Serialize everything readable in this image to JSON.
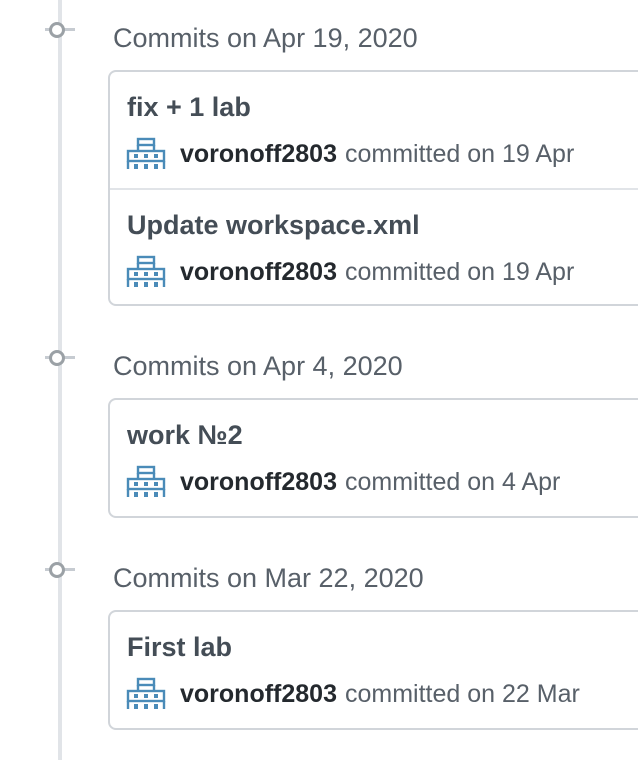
{
  "groups": [
    {
      "title": "Commits on Apr 19, 2020",
      "commits": [
        {
          "title": "fix + 1 lab",
          "author": "voronoff2803",
          "when": "committed on 19 Apr"
        },
        {
          "title": "Update workspace.xml",
          "author": "voronoff2803",
          "when": "committed on 19 Apr"
        }
      ]
    },
    {
      "title": "Commits on Apr 4, 2020",
      "commits": [
        {
          "title": "work №2",
          "author": "voronoff2803",
          "when": "committed on 4 Apr"
        }
      ]
    },
    {
      "title": "Commits on Mar 22, 2020",
      "commits": [
        {
          "title": "First lab",
          "author": "voronoff2803",
          "when": "committed on 22 Mar"
        }
      ]
    }
  ],
  "colors": {
    "avatar": "#4a8bb8",
    "timeline": "#e1e4e8",
    "border": "#d1d5da"
  },
  "icons": {
    "timeline_dot": "commit-dot-icon",
    "avatar": "identicon-avatar"
  }
}
